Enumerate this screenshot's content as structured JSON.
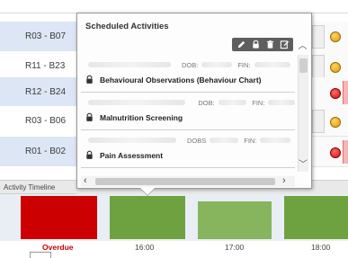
{
  "rooms": [
    {
      "label": "R03 - B07",
      "status": "orange"
    },
    {
      "label": "R11 - B23",
      "status": "orange"
    },
    {
      "label": "R12 - B24",
      "status": "red"
    },
    {
      "label": "R03 - B06",
      "status": "orange"
    },
    {
      "label": "R01 - B02",
      "status": "red"
    }
  ],
  "popup": {
    "title": "Scheduled Activities",
    "toolbar": [
      "edit-icon",
      "lock-icon",
      "delete-icon",
      "note-icon"
    ],
    "items": [
      {
        "dob_label": "DOB:",
        "fin_label": "FIN:",
        "title": "Behavioural Observations (Behaviour Chart)"
      },
      {
        "dob_label": "DOB:",
        "fin_label": "FIN:",
        "title": "Malnutrition Screening"
      },
      {
        "dob_label": "DOBS",
        "fin_label": "FIN:",
        "title": "Pain Assessment"
      }
    ]
  },
  "timeline": {
    "label": "Activity Timeline",
    "slots": [
      {
        "label": "Overdue",
        "color": "#cc0000"
      },
      {
        "label": "16:00",
        "color": "#6ea241"
      },
      {
        "label": "17:00",
        "color": "#86b55d"
      },
      {
        "label": "18:00",
        "color": "#6ea241"
      }
    ]
  },
  "colors": {
    "overdue": "#cc0000",
    "scheduled": "#6ea241",
    "row_alt": "#dde6f5"
  }
}
